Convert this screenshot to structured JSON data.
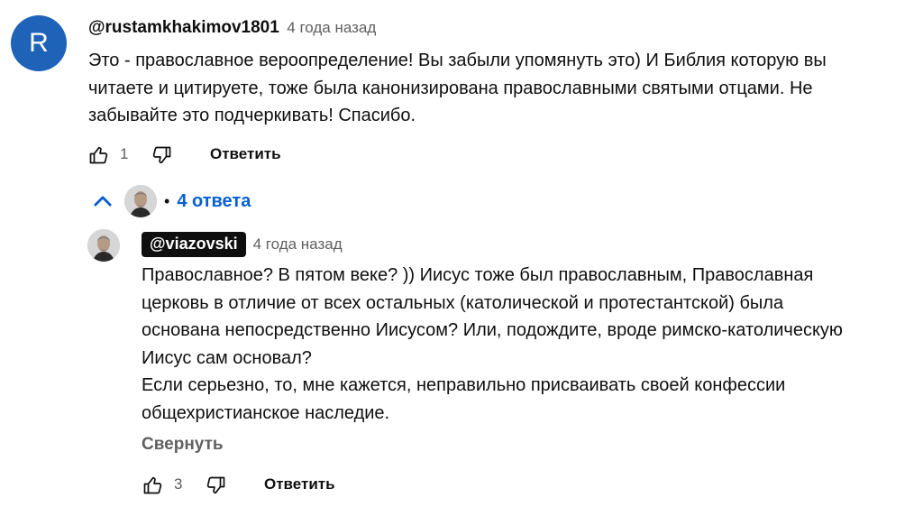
{
  "comment": {
    "avatar_letter": "R",
    "author": "@rustamkhakimov1801",
    "time": "4 года назад",
    "text": "Это - православное вероопределение! Вы забыли упомянуть это) И Библия которую вы\nчитаете и цитируете, тоже была канонизирована православными святыми отцами. Не\nзабывайте это подчеркивать! Спасибо.",
    "likes": "1",
    "reply_label": "Ответить"
  },
  "replies_toggle": {
    "dot": "•",
    "label": "4 ответа"
  },
  "reply": {
    "author": "@viazovski",
    "time": "4 года назад",
    "text": "Православное? В пятом веке? )) Иисус тоже был православным, Православная\nцерковь в отличие от всех остальных (католической и протестантской) была\nоснована непосредственно Иисусом? Или, подождите, вроде римско-католическую\nИисус сам основал?\nЕсли серьезно, то, мне кажется, неправильно присваивать своей конфессии\nобщехристианское наследие.",
    "collapse_label": "Свернуть",
    "likes": "3",
    "reply_label": "Ответить"
  },
  "colors": {
    "avatar_bg": "#1e63b8",
    "link_blue": "#065fd4",
    "secondary_text": "#606060",
    "chip_bg": "#0f0f0f"
  },
  "icons": [
    "thumbs-up-icon",
    "thumbs-down-icon",
    "chevron-up-icon"
  ]
}
